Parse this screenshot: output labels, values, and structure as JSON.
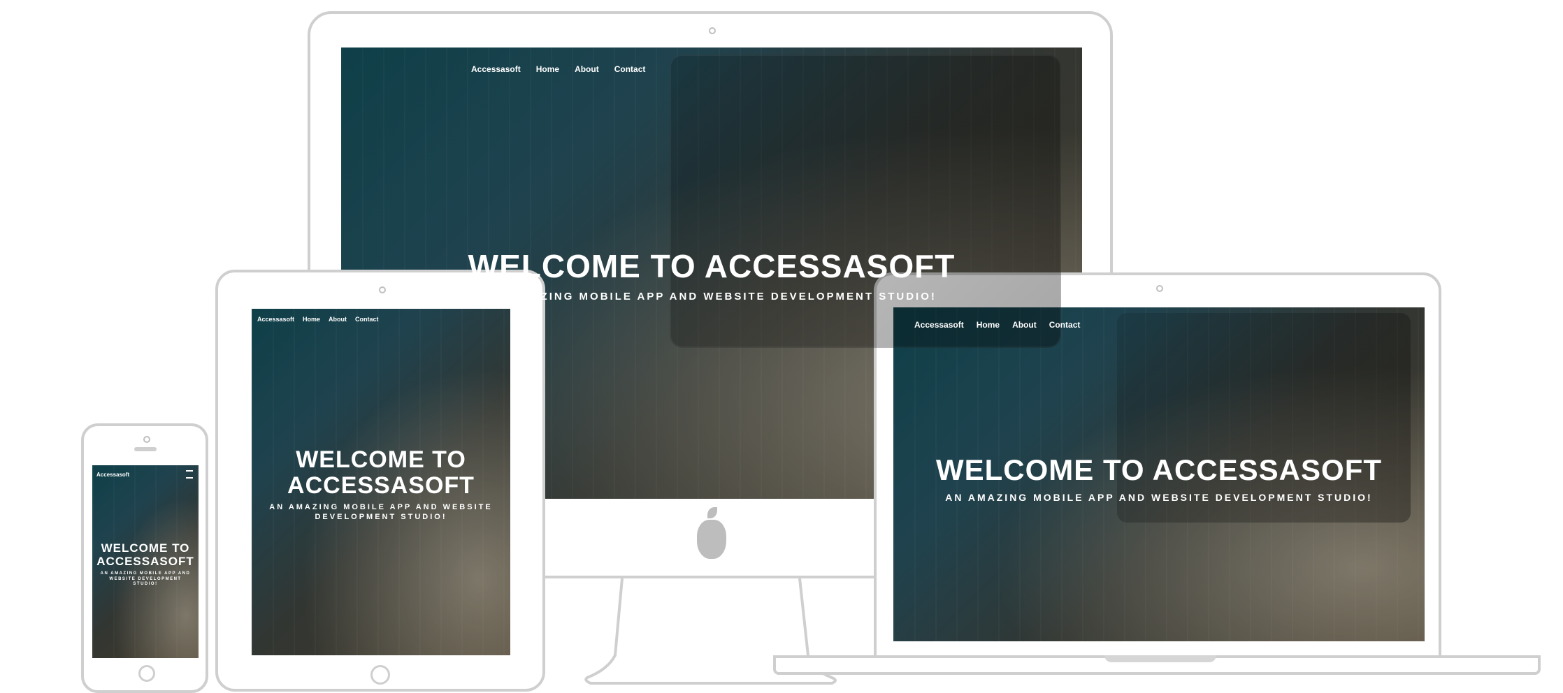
{
  "brand": "Accessasoft",
  "nav": [
    "Home",
    "About",
    "Contact"
  ],
  "hero": {
    "title": "WELCOME TO ACCESSASOFT",
    "subtitle": "AN AMAZING MOBILE APP AND WEBSITE DEVELOPMENT STUDIO!"
  },
  "phone": {
    "title_line1": "WELCOME TO",
    "title_line2": "ACCESSASOFT",
    "subtitle_line1": "AN AMAZING MOBILE APP AND",
    "subtitle_line2": "WEBSITE DEVELOPMENT",
    "subtitle_line3": "STUDIO!"
  },
  "tablet": {
    "title_line1": "WELCOME TO",
    "title_line2": "ACCESSASOFT",
    "subtitle_line1": "AN AMAZING MOBILE APP AND WEBSITE",
    "subtitle_line2": "DEVELOPMENT STUDIO!"
  },
  "colors": {
    "frame": "#cfcfcf",
    "screen_dark": "#114a55",
    "screen_warm": "#4f4533",
    "text": "#ffffff"
  },
  "icons": {
    "menu": "hamburger-menu-icon",
    "camera": "camera-icon",
    "home": "home-button-icon",
    "apple": "apple-logo-icon"
  }
}
